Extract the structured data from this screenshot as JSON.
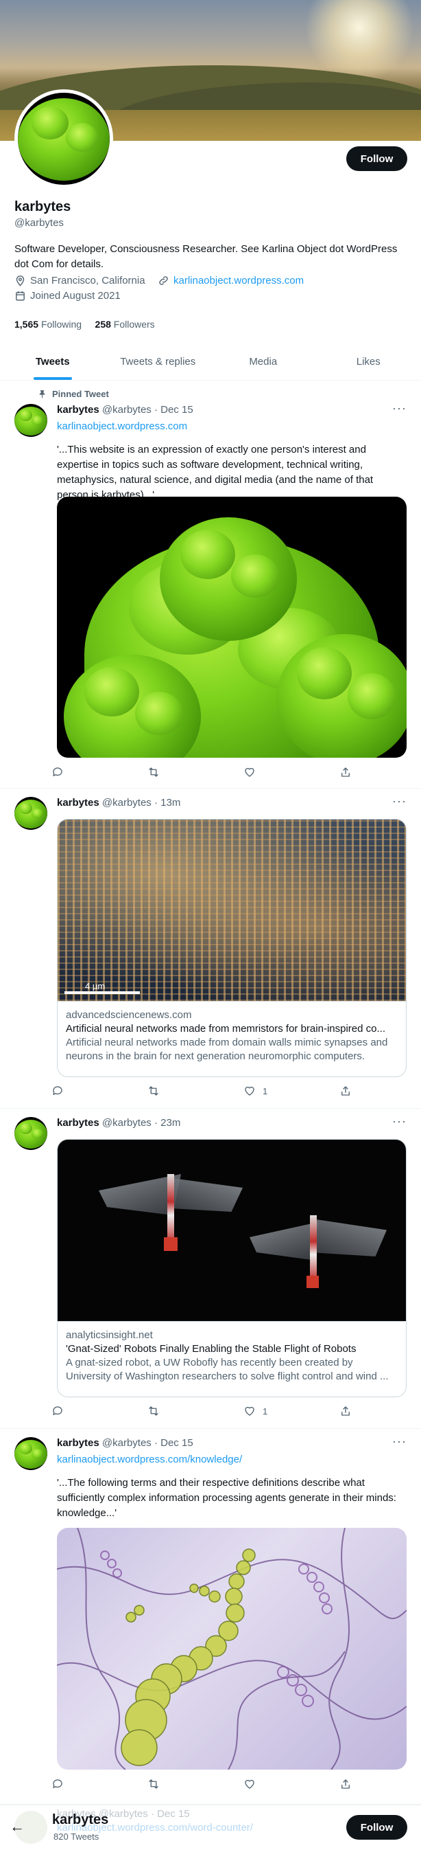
{
  "profile": {
    "name": "karbytes",
    "handle": "@karbytes",
    "bio": "Software Developer, Consciousness Researcher. See Karlina Object dot WordPress dot Com for details.",
    "location": "San Francisco, California",
    "website": "karlinaobject.wordpress.com",
    "joined": "Joined August 2021",
    "following_count": "1,565",
    "following_label": "Following",
    "followers_count": "258",
    "followers_label": "Followers",
    "follow_label": "Follow"
  },
  "tabs": [
    {
      "label": "Tweets",
      "active": true
    },
    {
      "label": "Tweets & replies",
      "active": false
    },
    {
      "label": "Media",
      "active": false
    },
    {
      "label": "Likes",
      "active": false
    }
  ],
  "tweets": [
    {
      "pinned_label": "Pinned Tweet",
      "name": "karbytes",
      "meta": "@karbytes · Dec 15",
      "link": "karlinaobject.wordpress.com",
      "text": "'...This website is an expression of exactly one person's interest and expertise in topics such as software development, technical writing, metaphysics, natural science, and digital media (and the name of that person is karbytes)...'",
      "likes": ""
    },
    {
      "name": "karbytes",
      "meta": "@karbytes · 13m",
      "card": {
        "scale_label": "4 µm",
        "domain": "advancedsciencenews.com",
        "title": "Artificial neural networks made from memristors for brain-inspired co...",
        "description": "Artificial neural networks made from domain walls mimic synapses and neurons in the brain for next generation neuromorphic computers."
      },
      "likes": "1"
    },
    {
      "name": "karbytes",
      "meta": "@karbytes · 23m",
      "card": {
        "domain": "analyticsinsight.net",
        "title": "'Gnat-Sized' Robots Finally Enabling the Stable Flight of Robots",
        "description": "A gnat-sized robot, a UW Robofly has recently been created by University of Washington researchers to solve flight control and wind ..."
      },
      "likes": "1"
    },
    {
      "name": "karbytes",
      "meta": "@karbytes · Dec 15",
      "link": "karlinaobject.wordpress.com/knowledge/",
      "text": "'...The following terms and their respective definitions describe what sufficiently complex information processing agents generate in their minds: knowledge...'",
      "likes": ""
    }
  ],
  "bottom_bar": {
    "name": "karbytes",
    "tweet_count": "820 Tweets",
    "peek_meta": "karbytes @karbytes · Dec 15",
    "peek_link": "karlinaobject.wordpress.com/word-counter/",
    "follow_label": "Follow"
  },
  "icons": [
    "location-icon",
    "link-icon",
    "calendar-icon",
    "pin-icon",
    "reply-icon",
    "retweet-icon",
    "like-icon",
    "share-icon",
    "more-icon",
    "back-arrow-icon"
  ],
  "colors": {
    "accent": "#1d9bf0",
    "text": "#0f1419",
    "muted": "#536471",
    "border": "#eff3f4"
  }
}
